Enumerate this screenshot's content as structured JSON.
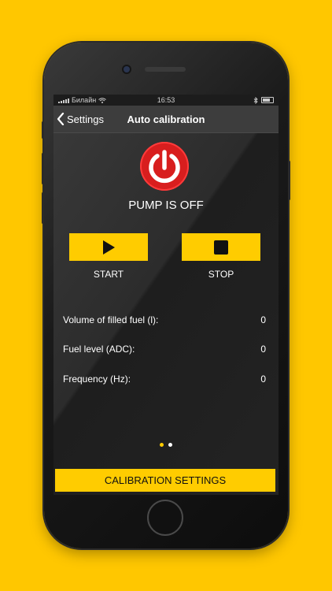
{
  "colors": {
    "background": "#FFC700",
    "accent": "#FFCC00",
    "power_red": "#d81e1e"
  },
  "status_bar": {
    "carrier": "Билайн",
    "time": "16:53"
  },
  "nav": {
    "back_label": "Settings",
    "title": "Auto calibration"
  },
  "pump": {
    "status": "PUMP IS OFF"
  },
  "controls": {
    "start_label": "START",
    "stop_label": "STOP"
  },
  "readings": [
    {
      "label": "Volume of filled fuel (l):",
      "value": "0"
    },
    {
      "label": "Fuel level (ADC):",
      "value": "0"
    },
    {
      "label": "Frequency (Hz):",
      "value": "0"
    }
  ],
  "pager": {
    "pages": 2,
    "active": 1
  },
  "footer": {
    "calibration_label": "CALIBRATION SETTINGS"
  }
}
